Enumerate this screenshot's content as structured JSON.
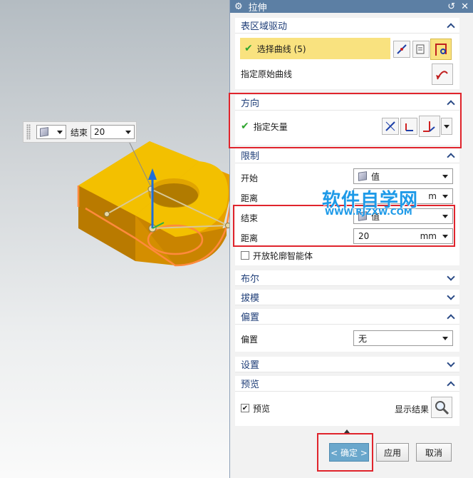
{
  "title": "拉伸",
  "mini_toolbar": {
    "end_label": "结束",
    "end_value": "20"
  },
  "sections": {
    "section_driving": "表区域驱动",
    "direction": "方向",
    "limits": "限制",
    "boolean": "布尔",
    "draft": "拔模",
    "offset": "偏置",
    "settings": "设置",
    "preview": "预览"
  },
  "section_driving": {
    "select_curve": "选择曲线 (5)",
    "specify_origin_curve": "指定原始曲线"
  },
  "direction": {
    "specify_vector": "指定矢量"
  },
  "limits": {
    "start_label": "开始",
    "start_value": "值",
    "distance1_label": "距离",
    "distance1_unit": "m",
    "end_label": "结束",
    "end_value": "值",
    "distance2_label": "距离",
    "distance2_value": "20",
    "distance2_unit": "mm",
    "open_profile": "开放轮廓智能体"
  },
  "offset": {
    "label": "偏置",
    "value": "无"
  },
  "preview": {
    "preview_label": "预览",
    "show_result": "显示结果"
  },
  "buttons": {
    "ok": "< 确定 >",
    "apply": "应用",
    "cancel": "取消"
  },
  "watermark": {
    "main": "软件自学网",
    "sub": "WWW.RJZXW.COM"
  },
  "colors": {
    "highlight": "#f9e27f",
    "header_text": "#1f3e78",
    "titlebar": "#5c7fa4",
    "annotation_red": "#e0242c",
    "solid": "#f2b705",
    "ok_button": "#6aa7cc"
  }
}
